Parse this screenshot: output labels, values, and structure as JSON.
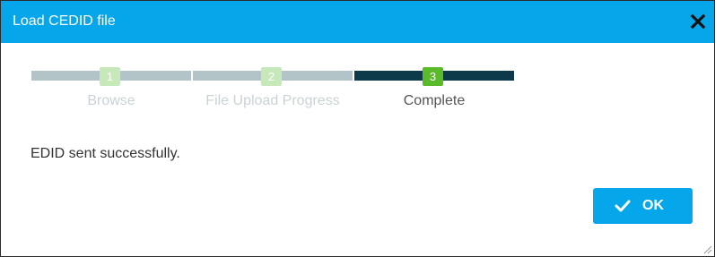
{
  "dialog": {
    "title": "Load CEDID file",
    "close_icon": "close-icon",
    "message": "EDID sent successfully.",
    "ok_label": "OK",
    "ok_icon": "checkmark-icon",
    "resize_icon": "resize-grip-icon"
  },
  "steps": [
    {
      "number": "1",
      "label": "Browse",
      "state": "completed"
    },
    {
      "number": "2",
      "label": "File Upload Progress",
      "state": "completed"
    },
    {
      "number": "3",
      "label": "Complete",
      "state": "current"
    }
  ],
  "colors": {
    "titlebar": "#05a6ea",
    "button": "#05a6ea",
    "step_bar_done": "#b3c4c9",
    "step_bar_current": "#0d3a4a",
    "step_num_done": "#c7e8b8",
    "step_num_current": "#5aba2a",
    "step_label_done": "#c9d3d6",
    "step_label_current": "#555555"
  }
}
